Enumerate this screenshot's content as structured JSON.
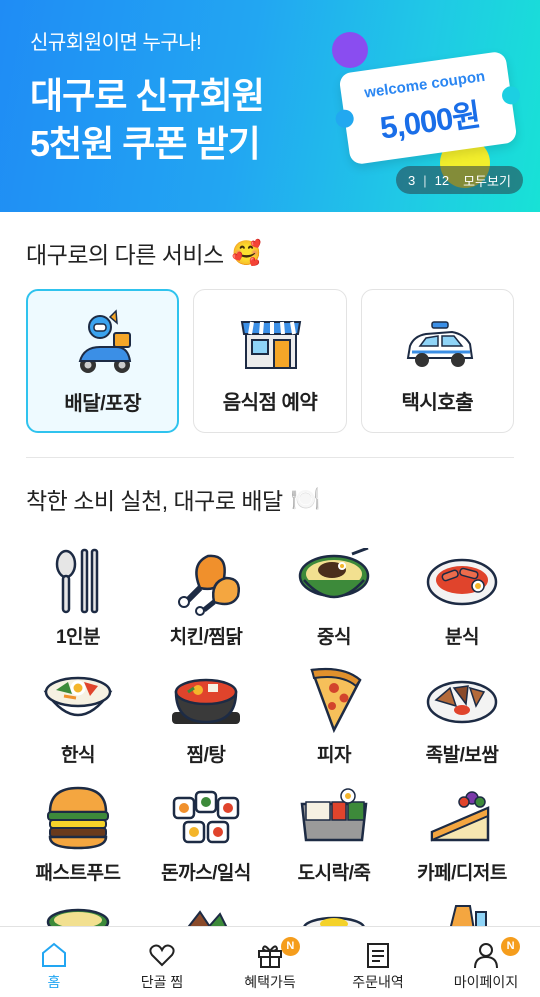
{
  "banner": {
    "subtitle": "신규회원이면 누구나!",
    "title_line1": "대구로 신규회원",
    "title_line2": "5천원 쿠폰 받기",
    "coupon_label": "welcome coupon",
    "coupon_amount": "5,000원",
    "pager_current": "3",
    "pager_separator": "|",
    "pager_total": "12",
    "view_all": "모두보기"
  },
  "services": {
    "title": "대구로의 다른 서비스",
    "title_emoji": "🥰",
    "items": [
      {
        "label": "배달/포장",
        "icon": "delivery-scooter-icon",
        "selected": true
      },
      {
        "label": "음식점 예약",
        "icon": "restaurant-store-icon",
        "selected": false
      },
      {
        "label": "택시호출",
        "icon": "taxi-icon",
        "selected": false
      }
    ]
  },
  "categories": {
    "title": "착한 소비 실천, 대구로 배달",
    "title_emoji": "🍽️",
    "items": [
      {
        "label": "1인분",
        "icon": "spoon-chopsticks-icon"
      },
      {
        "label": "치킨/찜닭",
        "icon": "chicken-icon"
      },
      {
        "label": "중식",
        "icon": "jajangmyeon-icon"
      },
      {
        "label": "분식",
        "icon": "tteokbokki-icon"
      },
      {
        "label": "한식",
        "icon": "bibimbap-icon"
      },
      {
        "label": "찜/탕",
        "icon": "stew-pot-icon"
      },
      {
        "label": "피자",
        "icon": "pizza-icon"
      },
      {
        "label": "족발/보쌈",
        "icon": "jokbal-icon"
      },
      {
        "label": "패스트푸드",
        "icon": "burger-icon"
      },
      {
        "label": "돈까스/일식",
        "icon": "sushi-icon"
      },
      {
        "label": "도시락/죽",
        "icon": "lunchbox-icon"
      },
      {
        "label": "카페/디저트",
        "icon": "cake-icon"
      }
    ]
  },
  "bottom_nav": {
    "items": [
      {
        "label": "홈",
        "icon": "home-icon",
        "active": true
      },
      {
        "label": "단골 찜",
        "icon": "heart-icon",
        "active": false
      },
      {
        "label": "혜택가득",
        "icon": "gift-icon",
        "active": false,
        "badge": "N"
      },
      {
        "label": "주문내역",
        "icon": "receipt-icon",
        "active": false
      },
      {
        "label": "마이페이지",
        "icon": "person-icon",
        "active": false,
        "badge": "N"
      }
    ]
  },
  "colors": {
    "accent": "#22a6f2",
    "badge": "#f59d1c",
    "selected_border": "#2fc3ee"
  }
}
